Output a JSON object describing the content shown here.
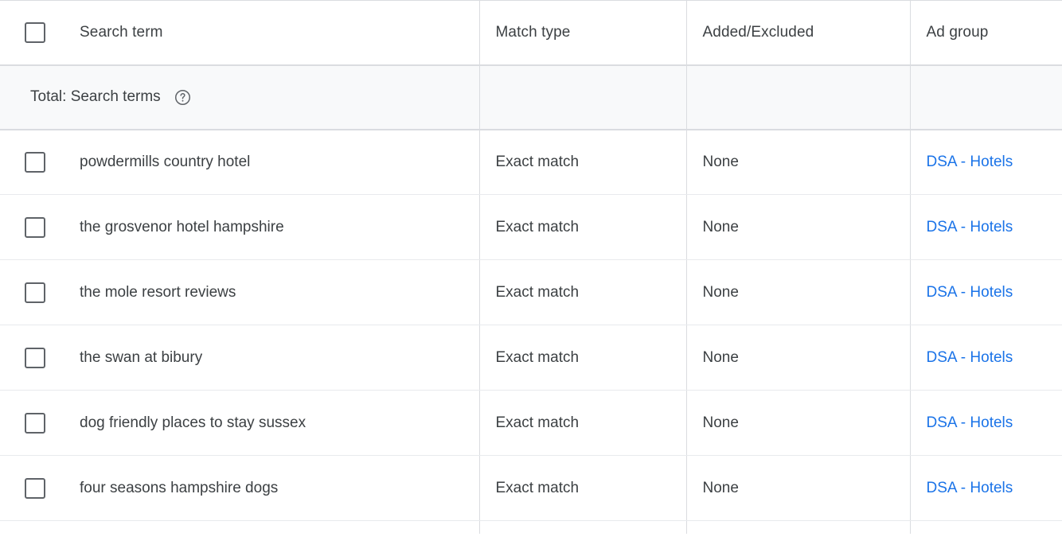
{
  "table": {
    "columns": [
      {
        "key": "search_term",
        "label": "Search term"
      },
      {
        "key": "match_type",
        "label": "Match type"
      },
      {
        "key": "added_excluded",
        "label": "Added/Excluded"
      },
      {
        "key": "ad_group",
        "label": "Ad group"
      }
    ],
    "totals": {
      "label": "Total: Search terms",
      "help_icon": "help-circle-icon",
      "match_type": "",
      "added_excluded": "",
      "ad_group": ""
    },
    "select_all_checkbox": "checkbox-unchecked",
    "rows": [
      {
        "search_term": "powdermills country hotel",
        "match_type": "Exact match",
        "added_excluded": "None",
        "ad_group": "DSA - Hotels"
      },
      {
        "search_term": "the grosvenor hotel hampshire",
        "match_type": "Exact match",
        "added_excluded": "None",
        "ad_group": "DSA - Hotels"
      },
      {
        "search_term": "the mole resort reviews",
        "match_type": "Exact match",
        "added_excluded": "None",
        "ad_group": "DSA - Hotels"
      },
      {
        "search_term": "the swan at bibury",
        "match_type": "Exact match",
        "added_excluded": "None",
        "ad_group": "DSA - Hotels"
      },
      {
        "search_term": "dog friendly places to stay sussex",
        "match_type": "Exact match",
        "added_excluded": "None",
        "ad_group": "DSA - Hotels"
      },
      {
        "search_term": "four seasons hampshire dogs",
        "match_type": "Exact match",
        "added_excluded": "None",
        "ad_group": "DSA - Hotels"
      }
    ]
  },
  "colors": {
    "link": "#1a73e8",
    "text": "#3c4043",
    "border": "#dadce0",
    "row_border": "#e8eaed",
    "totals_background": "#f8f9fa",
    "checkbox_border": "#5f6368"
  }
}
